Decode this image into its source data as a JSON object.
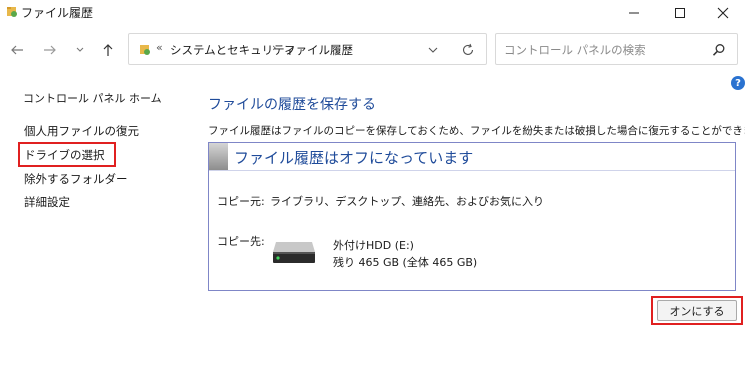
{
  "window": {
    "title": "ファイル履歴",
    "controls": [
      "minimize",
      "maximize",
      "close"
    ]
  },
  "nav": {
    "address": {
      "separator": "«",
      "crumbs": [
        "システムとセキュリティ",
        "ファイル履歴"
      ],
      "crumb_arrow": "›"
    },
    "search": {
      "placeholder": "コントロール パネルの検索"
    }
  },
  "sidebar": {
    "home": "コントロール パネル ホーム",
    "items": [
      {
        "label": "個人用ファイルの復元"
      },
      {
        "label": "ドライブの選択",
        "highlighted": true
      },
      {
        "label": "除外するフォルダー"
      },
      {
        "label": "詳細設定"
      }
    ]
  },
  "help": {
    "label": "?"
  },
  "main": {
    "heading": "ファイルの履歴を保存する",
    "description": "ファイル履歴はファイルのコピーを保存しておくため、ファイルを紛失または破損した場合に復元することができます。",
    "status": {
      "title": "ファイル履歴はオフになっています",
      "copy_from_label": "コピー元:",
      "copy_from_value": "ライブラリ、デスクトップ、連絡先、およびお気に入り",
      "copy_to_label": "コピー先:",
      "drive_name": "外付けHDD (E:)",
      "drive_space": "残り 465 GB (全体 465 GB)"
    },
    "turn_on_button": "オンにする"
  },
  "colors": {
    "accent_text": "#1f4b9a",
    "highlight_box": "#e02020",
    "status_border": "#7f86c7",
    "help_blue": "#2a72d0"
  }
}
